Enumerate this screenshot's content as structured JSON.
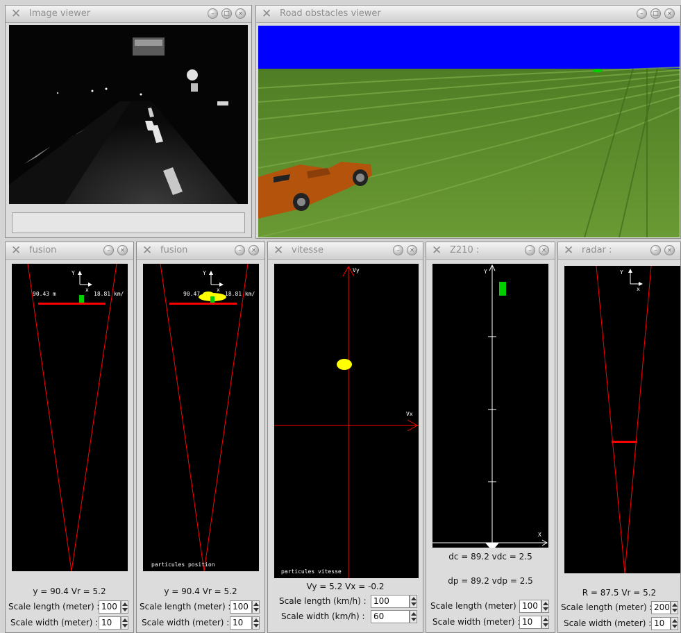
{
  "windows": {
    "image_viewer": {
      "title": "Image viewer"
    },
    "road_viewer": {
      "title": "Road obstacles viewer"
    },
    "fusion1": {
      "title": "fusion",
      "axis_y": "Y",
      "axis_x": "x",
      "label_left": "90.43 m",
      "label_right": "18.81 km/",
      "readout": "y = 90.4 Vr = 5.2",
      "scale_length_label": "Scale length (meter) :",
      "scale_length_value": "100",
      "scale_width_label": "Scale width (meter) :",
      "scale_width_value": "10"
    },
    "fusion2": {
      "title": "fusion",
      "axis_y": "Y",
      "axis_x": "x",
      "label_left": "90.47",
      "label_right": "18.81 km/",
      "caption": "particules position",
      "readout": "y = 90.4 Vr = 5.2",
      "scale_length_label": "Scale length (meter) :",
      "scale_length_value": "100",
      "scale_width_label": "Scale width (meter) :",
      "scale_width_value": "10"
    },
    "vitesse": {
      "title": "vitesse",
      "axis_vy": "Vy",
      "axis_vx": "Vx",
      "caption": "particules vitesse",
      "readout": "Vy = 5.2 Vx = -0.2",
      "scale_length_label": "Scale length (km/h) :",
      "scale_length_value": "100",
      "scale_width_label": "Scale width (km/h) :",
      "scale_width_value": "60"
    },
    "z210": {
      "title": "Z210 :",
      "axis_y": "Y",
      "axis_x": "X",
      "readout_dc": "dc = 89.2 vdc = 2.5",
      "readout_dp": "dp = 89.2 vdp = 2.5",
      "scale_length_label": "Scale length (meter) :",
      "scale_length_value": "100",
      "scale_width_label": "Scale width (meter) :",
      "scale_width_value": "10"
    },
    "radar": {
      "title": "radar :",
      "axis_y": "Y",
      "axis_x": "x",
      "readout": "R = 87.5 Vr = 5.2",
      "scale_length_label": "Scale length (meter) :",
      "scale_length_value": "200",
      "scale_width_label": "Scale width (meter) :",
      "scale_width_value": "10"
    }
  },
  "icons": {
    "window_menu": "x-mark-icon",
    "minimize": "minimize-icon",
    "maximize": "maximize-icon",
    "close": "close-icon"
  },
  "colors": {
    "sky": "#0000ff",
    "grass": "#5f8f2a",
    "car": "#b3530c",
    "sensor_line": "#ff0000",
    "target": "#00d000",
    "particles": "#ffff00"
  }
}
